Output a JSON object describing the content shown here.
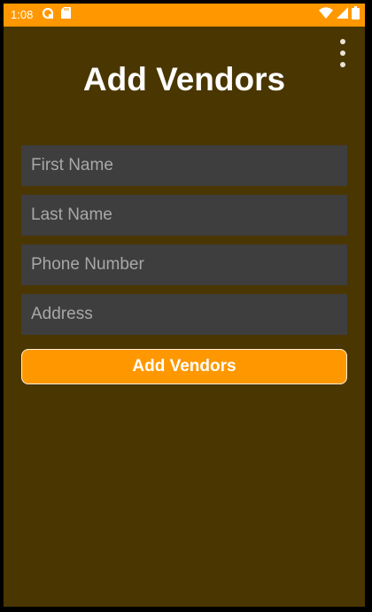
{
  "status_bar": {
    "time": "1:08",
    "left_icons": [
      "sync-icon",
      "sd-card-icon"
    ],
    "right_icons": [
      "wifi-icon",
      "signal-icon",
      "battery-icon"
    ],
    "color": "#FF9800"
  },
  "app": {
    "title": "Add Vendors",
    "background": "#4A3600",
    "overflow_menu_icon": "more-vert-icon"
  },
  "form": {
    "first_name": {
      "value": "",
      "placeholder": "First Name"
    },
    "last_name": {
      "value": "",
      "placeholder": "Last Name"
    },
    "phone_number": {
      "value": "",
      "placeholder": "Phone Number"
    },
    "address": {
      "value": "",
      "placeholder": "Address"
    },
    "submit_label": "Add Vendors",
    "accent_color": "#FF9800",
    "field_color": "#3E3E3E"
  }
}
